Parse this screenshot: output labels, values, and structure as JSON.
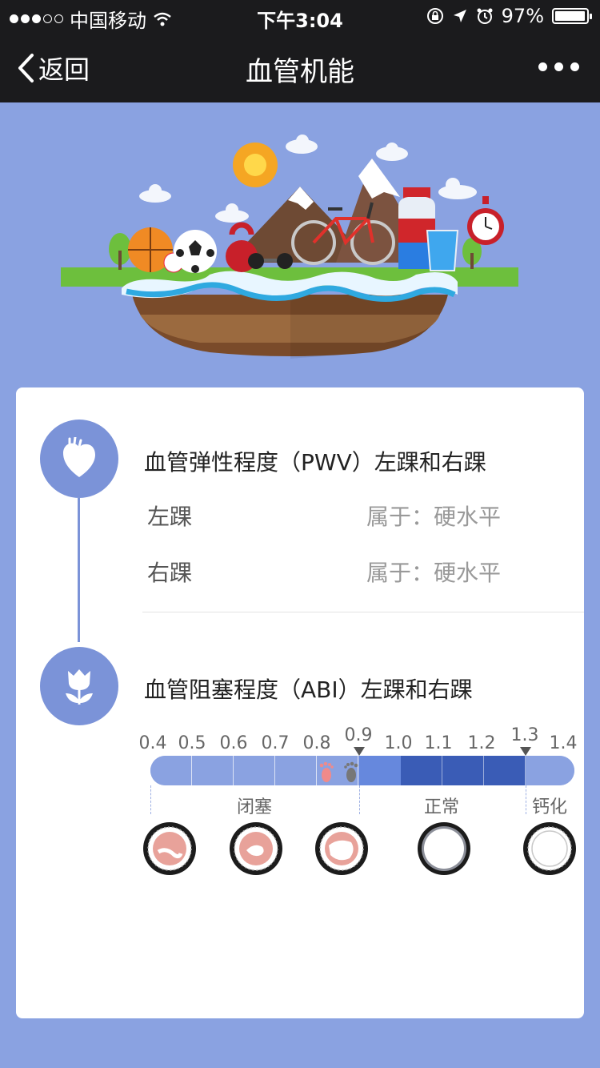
{
  "status_bar": {
    "carrier": "中国移动",
    "time": "下午3:04",
    "battery": "97%",
    "battery_level": 0.97
  },
  "nav": {
    "back_label": "返回",
    "title": "血管机能"
  },
  "pwv": {
    "title": "血管弹性程度（PWV）左踝和右踝",
    "rows": [
      {
        "label": "左踝",
        "value": "属于：硬水平"
      },
      {
        "label": "右踝",
        "value": "属于：硬水平"
      }
    ]
  },
  "abi": {
    "title": "血管阻塞程度（ABI）左踝和右踝",
    "ticks": [
      "0.4",
      "0.5",
      "0.6",
      "0.7",
      "0.8",
      "0.9",
      "1.0",
      "1.1",
      "1.2",
      "1.3",
      "1.4"
    ],
    "markers": [
      "0.9",
      "1.3"
    ],
    "zones": [
      {
        "label": "闭塞",
        "from": "0.4",
        "to": "0.9"
      },
      {
        "label": "正常",
        "from": "0.9",
        "to": "1.3"
      },
      {
        "label": "钙化",
        "from": "1.3",
        "to": "1.4"
      }
    ],
    "colors": {
      "occlusion": "#8aa2e1",
      "normal_light": "#6688dd",
      "normal_dark": "#3a5cb6",
      "calcification": "#8aa2e1"
    }
  },
  "theme": {
    "header_bg": "#1b1b1d",
    "page_bg": "#8aa2e1",
    "accent": "#7b93d8"
  }
}
